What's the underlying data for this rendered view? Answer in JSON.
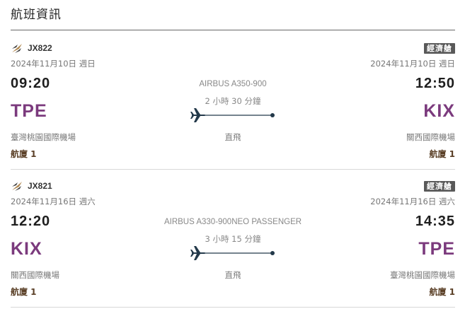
{
  "page": {
    "title": "航班資訊"
  },
  "colors": {
    "airport_code": "#7b3a7d",
    "terminal": "#5a3f26",
    "badge_bg": "#595959",
    "route_line": "#23394a",
    "logo_gold": "#b28a53"
  },
  "flights": [
    {
      "logo_icon": "airline-logo-icon",
      "flight_no": "JX822",
      "cabin": "經濟艙",
      "depart": {
        "date": "2024年11月10日 週日",
        "time": "09:20",
        "code": "TPE",
        "airport": "臺灣桃園國際機場",
        "terminal": "航廈 1"
      },
      "arrive": {
        "date": "2024年11月10日 週日",
        "time": "12:50",
        "code": "KIX",
        "airport": "關西國際機場",
        "terminal": "航廈 1"
      },
      "aircraft": "AIRBUS A350-900",
      "duration": "2 小時 30 分鐘",
      "stops": "直飛"
    },
    {
      "logo_icon": "airline-logo-icon",
      "flight_no": "JX821",
      "cabin": "經濟艙",
      "depart": {
        "date": "2024年11月16日 週六",
        "time": "12:20",
        "code": "KIX",
        "airport": "關西國際機場",
        "terminal": "航廈 1"
      },
      "arrive": {
        "date": "2024年11月16日 週六",
        "time": "14:35",
        "code": "TPE",
        "airport": "臺灣桃園國際機場",
        "terminal": "航廈 1"
      },
      "aircraft": "AIRBUS A330-900NEO PASSENGER",
      "duration": "3 小時 15 分鐘",
      "stops": "直飛"
    }
  ]
}
